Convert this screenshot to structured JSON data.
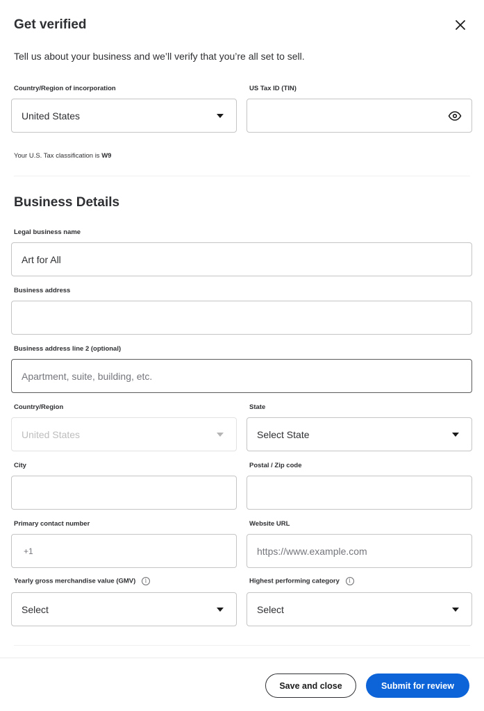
{
  "header": {
    "title": "Get verified",
    "close_icon": "close-icon"
  },
  "intro": "Tell us about your business and we’ll verify that you’re all set to sell.",
  "incorporation": {
    "country_label": "Country/Region of incorporation",
    "country_value": "United States",
    "tin_label": "US Tax ID (TIN)",
    "tin_value": "",
    "tin_icon": "eye-icon",
    "tax_note_prefix": "Your U.S. Tax classification is",
    "tax_note_value": "W9"
  },
  "business_details": {
    "title": "Business Details",
    "legal_name_label": "Legal business name",
    "legal_name_value": "Art for All",
    "address_label": "Business address",
    "address_value": "",
    "address2_label": "Business address line 2 (optional)",
    "address2_placeholder": "Apartment, suite, building, etc.",
    "country_label": "Country/Region",
    "country_value": "United States",
    "state_label": "State",
    "state_value": "Select State",
    "city_label": "City",
    "city_value": "",
    "zip_label": "Postal / Zip code",
    "zip_value": "",
    "phone_label": "Primary contact number",
    "phone_prefix": "+1",
    "website_label": "Website URL",
    "website_placeholder": "https://www.example.com",
    "gmv_label": "Yearly gross merchandise value (GMV)",
    "gmv_value": "Select",
    "category_label": "Highest performing category",
    "category_value": "Select",
    "info_icon_glyph": "i"
  },
  "footer": {
    "save_label": "Save and close",
    "submit_label": "Submit for review"
  },
  "colors": {
    "primary": "#0d64d8",
    "text": "#2e2f32",
    "border": "#c4c4c4"
  }
}
